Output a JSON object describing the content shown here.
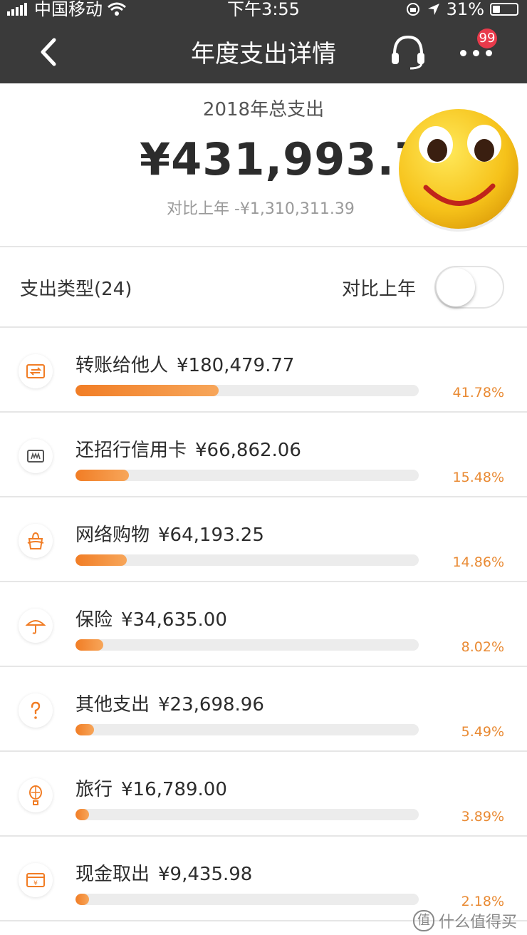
{
  "status_bar": {
    "carrier": "中国移动",
    "time": "下午3:55",
    "battery": "31%"
  },
  "nav": {
    "title": "年度支出详情",
    "badge": "99"
  },
  "summary": {
    "label": "2018年总支出",
    "total": "¥431,993.74",
    "compare": "对比上年 -¥1,310,311.39"
  },
  "types": {
    "label": "支出类型(24)",
    "compare_label": "对比上年",
    "compare_on": false
  },
  "items": [
    {
      "name": "转账给他人",
      "amount": "¥180,479.77",
      "percent": "41.78%",
      "fraction": 0.4178,
      "icon": "transfer-icon"
    },
    {
      "name": "还招行信用卡",
      "amount": "¥66,862.06",
      "percent": "15.48%",
      "fraction": 0.1548,
      "icon": "credit-card-icon"
    },
    {
      "name": "网络购物",
      "amount": "¥64,193.25",
      "percent": "14.86%",
      "fraction": 0.1486,
      "icon": "shopping-bag-icon"
    },
    {
      "name": "保险",
      "amount": "¥34,635.00",
      "percent": "8.02%",
      "fraction": 0.0802,
      "icon": "umbrella-icon"
    },
    {
      "name": "其他支出",
      "amount": "¥23,698.96",
      "percent": "5.49%",
      "fraction": 0.0549,
      "icon": "question-icon"
    },
    {
      "name": "旅行",
      "amount": "¥16,789.00",
      "percent": "3.89%",
      "fraction": 0.0389,
      "icon": "balloon-icon"
    },
    {
      "name": "现金取出",
      "amount": "¥9,435.98",
      "percent": "2.18%",
      "fraction": 0.0218,
      "icon": "cash-icon"
    }
  ],
  "watermark": "什么值得买",
  "colors": {
    "header": "#3a3a3a",
    "accent": "#f17d25",
    "badge": "#e83a4b"
  }
}
